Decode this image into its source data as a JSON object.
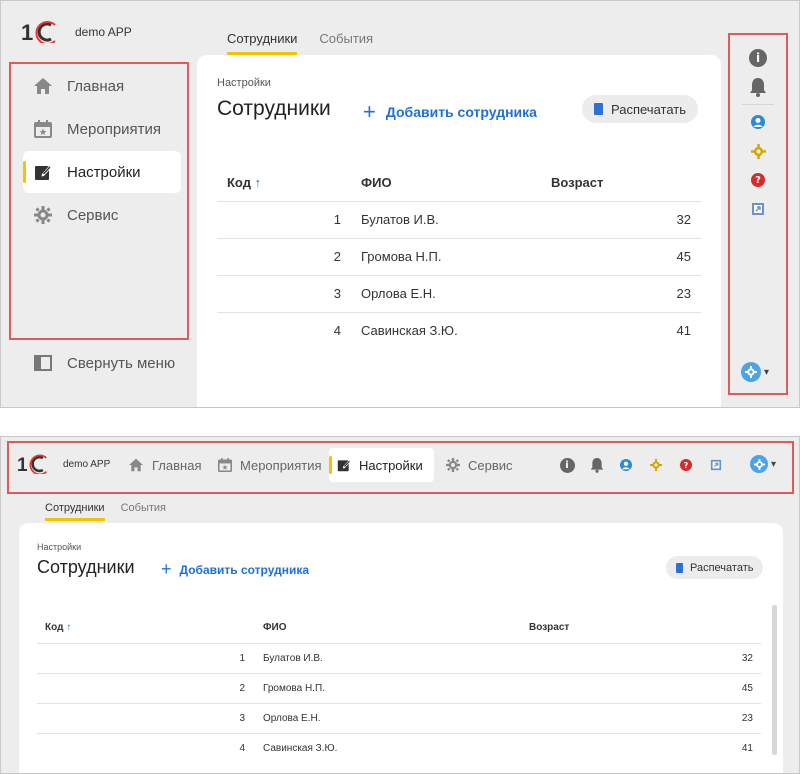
{
  "app": {
    "name": "demo APP"
  },
  "colors": {
    "accent_yellow": "#f2c500",
    "link_blue": "#1f6fd8",
    "highlight_red": "#e05a5a",
    "background": "#ededed"
  },
  "sidebar": {
    "items": [
      {
        "label": "Главная",
        "icon": "home-icon"
      },
      {
        "label": "Мероприятия",
        "icon": "calendar-star-icon"
      },
      {
        "label": "Настройки",
        "icon": "edit-icon",
        "active": true
      },
      {
        "label": "Сервис",
        "icon": "gear-icon"
      }
    ],
    "collapse_label": "Свернуть меню"
  },
  "tabs": [
    {
      "label": "Сотрудники",
      "active": true
    },
    {
      "label": "События"
    }
  ],
  "page": {
    "breadcrumb": "Настройки",
    "title": "Сотрудники",
    "add_label": "Добавить сотрудника",
    "print_label": "Распечатать"
  },
  "table": {
    "columns": [
      "Код",
      "ФИО",
      "Возраст"
    ],
    "sort_arrow": "↑",
    "rows": [
      {
        "code": "1",
        "name": "Булатов И.В.",
        "age": "32"
      },
      {
        "code": "2",
        "name": "Громова Н.П.",
        "age": "45"
      },
      {
        "code": "3",
        "name": "Орлова Е.Н.",
        "age": "23"
      },
      {
        "code": "4",
        "name": "Савинская З.Ю.",
        "age": "41"
      }
    ]
  },
  "toolbar": {
    "icons": [
      "info-icon",
      "bell-icon",
      "user-icon",
      "settings-icon",
      "help-icon",
      "external-link-icon"
    ],
    "info_glyph": "i",
    "help_glyph": "?"
  }
}
